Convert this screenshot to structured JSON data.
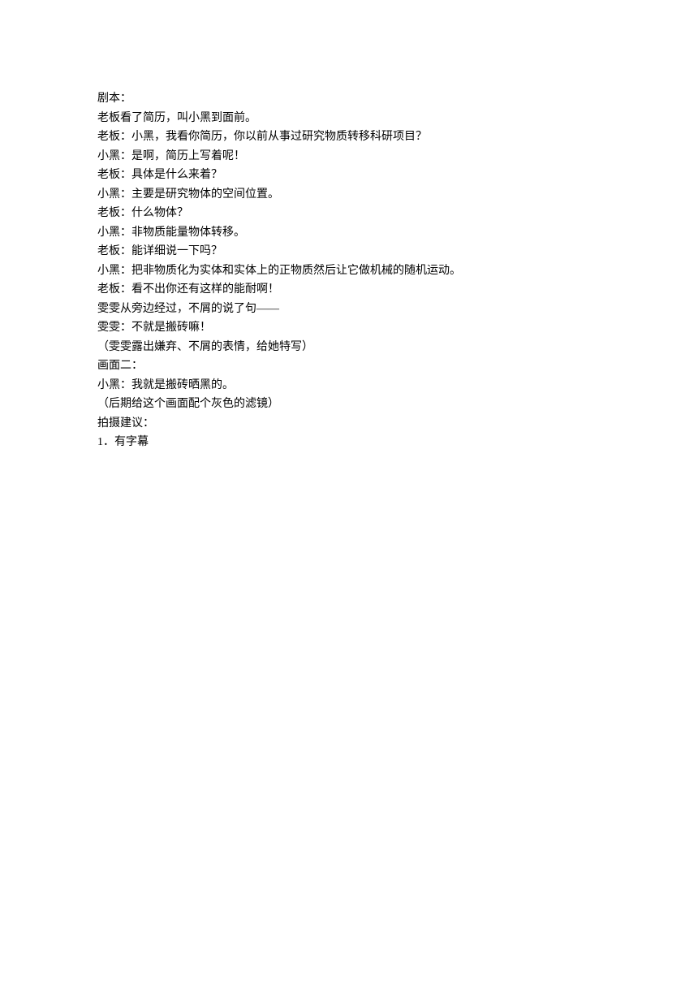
{
  "lines": [
    "剧本：",
    "老板看了简历，叫小黑到面前。",
    "老板：小黑，我看你简历，你以前从事过研究物质转移科研项目？",
    "小黑：是啊，简历上写着呢！",
    "老板：具体是什么来着？",
    "小黑：主要是研究物体的空间位置。",
    "老板：什么物体？",
    "小黑：非物质能量物体转移。",
    "老板：能详细说一下吗？",
    "小黑：把非物质化为实体和实体上的正物质然后让它做机械的随机运动。",
    "老板：看不出你还有这样的能耐啊！",
    "雯雯从旁边经过，不屑的说了句——",
    "雯雯：不就是搬砖嘛！",
    "（雯雯露出嫌弃、不屑的表情，给她特写）",
    "画面二：",
    "小黑：我就是搬砖晒黑的。",
    "（后期给这个画面配个灰色的滤镜）",
    "拍摄建议：",
    "1．有字幕"
  ]
}
